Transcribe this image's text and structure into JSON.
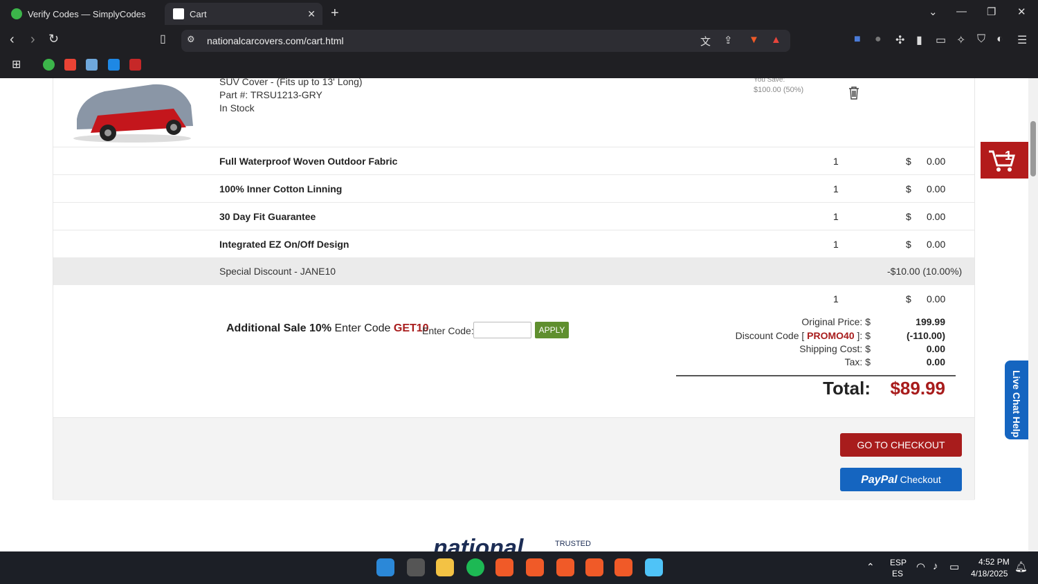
{
  "browser": {
    "tabs": [
      {
        "title": "Verify Codes — SimplyCodes"
      },
      {
        "title": "Cart"
      }
    ],
    "url": "nationalcarcovers.com/cart.html"
  },
  "product": {
    "name": "SUV Cover - (Fits up to 13' Long)",
    "part": "Part #: TRSU1213-GRY",
    "stock": "In Stock",
    "you_save_label": "You Save:",
    "you_save_value": "$100.00 (50%)"
  },
  "features": [
    {
      "name": "Full Waterproof Woven Outdoor Fabric",
      "qty": "1",
      "currency": "$",
      "price": "0.00"
    },
    {
      "name": "100% Inner Cotton Linning",
      "qty": "1",
      "currency": "$",
      "price": "0.00"
    },
    {
      "name": "30 Day Fit Guarantee",
      "qty": "1",
      "currency": "$",
      "price": "0.00"
    },
    {
      "name": "Integrated EZ On/Off Design",
      "qty": "1",
      "currency": "$",
      "price": "0.00"
    }
  ],
  "discount_row": {
    "label": "Special Discount - JANE10",
    "value": "-$10.00 (10.00%)"
  },
  "extra_row": {
    "qty": "1",
    "currency": "$",
    "price": "0.00"
  },
  "promo": {
    "lead": "Additional Sale 10%",
    "mid": "Enter Code",
    "code": "GET10",
    "input_label": "Enter Code:",
    "input_value": "",
    "apply": "APPLY"
  },
  "summary": {
    "original_label": "Original Price: $",
    "original_value": "199.99",
    "discount_pre": "Discount Code [",
    "discount_code": "PROMO40",
    "discount_post": "]: $",
    "discount_value": "(-110.00)",
    "shipping_label": "Shipping Cost: $",
    "shipping_value": "0.00",
    "tax_label": "Tax: $",
    "tax_value": "0.00",
    "total_label": "Total:",
    "total_value": "$89.99"
  },
  "buttons": {
    "checkout": "GO TO CHECKOUT",
    "paypal_brand": "PayPal",
    "paypal_text": "Checkout"
  },
  "side": {
    "cart_count": "1",
    "live_chat": "Live Chat Help"
  },
  "footer_logo": {
    "main": "national",
    "sub": "TRUSTED"
  },
  "taskbar": {
    "lang1": "ESP",
    "lang2": "ES",
    "time": "4:52 PM",
    "date": "4/18/2025"
  },
  "colors": {
    "brand_red": "#a81c1c",
    "paypal_blue": "#1565c0",
    "apply_green": "#5f8f2e"
  }
}
